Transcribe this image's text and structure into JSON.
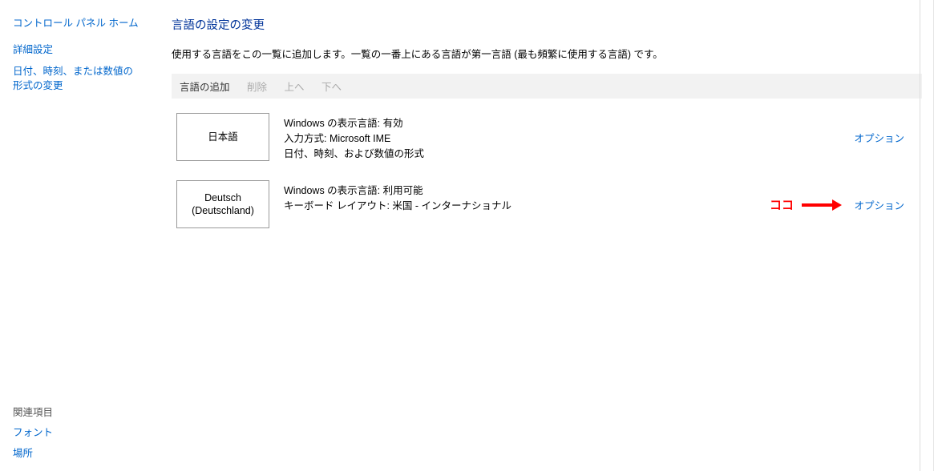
{
  "sidebar": {
    "home": "コントロール パネル ホーム",
    "advanced": "詳細設定",
    "dateformat": "日付、時刻、または数値の形式の変更",
    "related_title": "関連項目",
    "font": "フォント",
    "location": "場所"
  },
  "main": {
    "title": "言語の設定の変更",
    "description": "使用する言語をこの一覧に追加します。一覧の一番上にある言語が第一言語 (最も頻繁に使用する言語) です。"
  },
  "toolbar": {
    "add": "言語の追加",
    "remove": "削除",
    "up": "上へ",
    "down": "下へ"
  },
  "languages": [
    {
      "name_line1": "日本語",
      "name_line2": "",
      "detail_line1": "Windows の表示言語: 有効",
      "detail_line2": "入力方式: Microsoft IME",
      "detail_line3": "日付、時刻、および数値の形式",
      "options_label": "オプション"
    },
    {
      "name_line1": "Deutsch",
      "name_line2": "(Deutschland)",
      "detail_line1": "Windows の表示言語: 利用可能",
      "detail_line2": "キーボード レイアウト: 米国 - インターナショナル",
      "detail_line3": "",
      "options_label": "オプション"
    }
  ],
  "annotation": {
    "text": "ココ"
  }
}
